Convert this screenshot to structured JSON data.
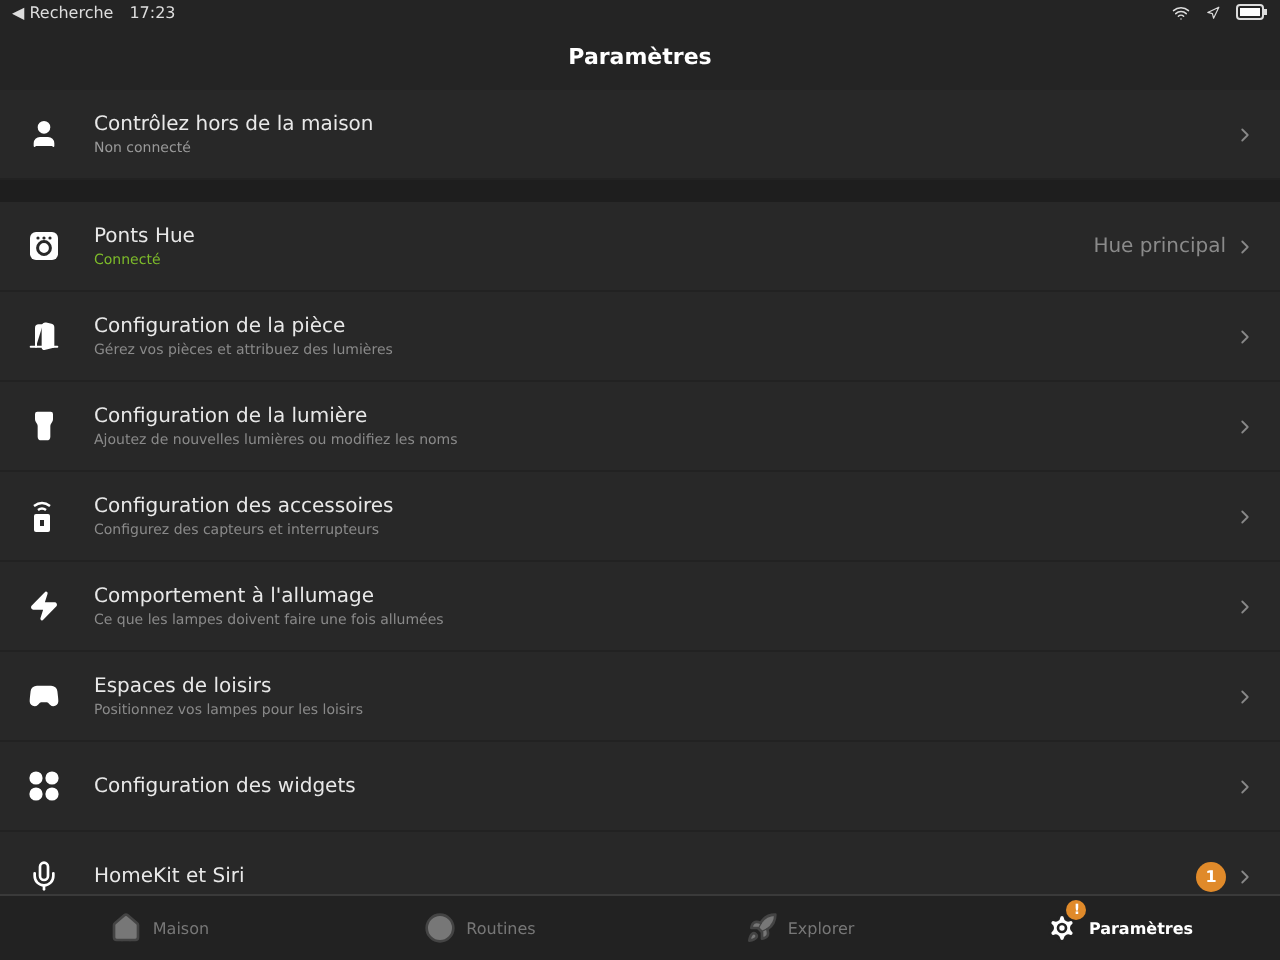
{
  "status_bar": {
    "back": "◀ Recherche",
    "time": "17:23"
  },
  "title": "Paramètres",
  "sections": [
    {
      "rows": [
        {
          "title": "Contrôlez hors de la maison",
          "subtitle": "Non connecté",
          "connected": false
        }
      ]
    },
    {
      "rows": [
        {
          "title": "Ponts Hue",
          "subtitle": "Connecté",
          "connected": true,
          "value": "Hue principal"
        },
        {
          "title": "Configuration de la pièce",
          "subtitle": "Gérez vos pièces et attribuez des lumières"
        },
        {
          "title": "Configuration de la lumière",
          "subtitle": "Ajoutez de nouvelles lumières ou modifiez les noms"
        },
        {
          "title": "Configuration des accessoires",
          "subtitle": "Configurez des capteurs et interrupteurs"
        },
        {
          "title": "Comportement à l'allumage",
          "subtitle": "Ce que les lampes doivent faire une fois allumées"
        },
        {
          "title": "Espaces de loisirs",
          "subtitle": "Positionnez vos lampes pour les loisirs"
        },
        {
          "title": "Configuration des widgets"
        },
        {
          "title": "HomeKit et Siri",
          "badge": "1"
        }
      ]
    }
  ],
  "tabs": [
    {
      "label": "Maison",
      "selected": false
    },
    {
      "label": "Routines",
      "selected": false
    },
    {
      "label": "Explorer",
      "selected": false
    },
    {
      "label": "Paramètres",
      "selected": true,
      "badge": "!"
    }
  ]
}
